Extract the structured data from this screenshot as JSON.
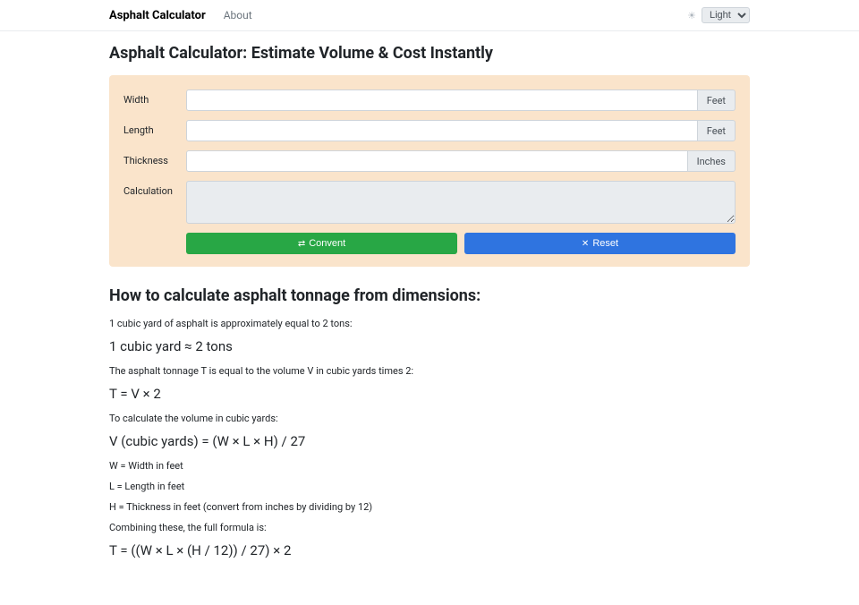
{
  "nav": {
    "brand": "Asphalt Calculator",
    "about": "About",
    "themeSelected": "Light"
  },
  "pageTitle": "Asphalt Calculator: Estimate Volume & Cost Instantly",
  "form": {
    "width": {
      "label": "Width",
      "unit": "Feet"
    },
    "length": {
      "label": "Length",
      "unit": "Feet"
    },
    "thickness": {
      "label": "Thickness",
      "unit": "Inches"
    },
    "calc": {
      "label": "Calculation"
    },
    "convertBtn": "Convent",
    "resetBtn": "Reset"
  },
  "explain": {
    "heading": "How to calculate asphalt tonnage from dimensions:",
    "p1": "1 cubic yard of asphalt is approximately equal to 2 tons:",
    "f1": "1 cubic yard ≈ 2 tons",
    "p2": "The asphalt tonnage T is equal to the volume V in cubic yards times 2:",
    "f2": "T = V × 2",
    "p3": "To calculate the volume in cubic yards:",
    "f3": "V (cubic yards) = (W × L × H) / 27",
    "p4": "W = Width in feet",
    "p5": "L = Length in feet",
    "p6": "H = Thickness in feet (convert from inches by dividing by 12)",
    "p7": "Combining these, the full formula is:",
    "f4": "T = ((W × L × (H / 12)) / 27) × 2"
  }
}
